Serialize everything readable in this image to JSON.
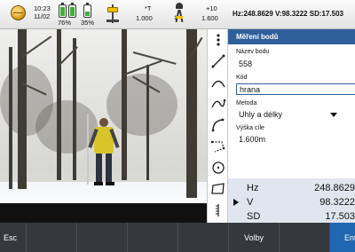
{
  "status_bar": {
    "globe_icon": "globe-icon",
    "time": "10:23",
    "date": "11/02",
    "battery1_percent": "76%",
    "battery1_level": 0.76,
    "battery2_percent": "35%",
    "battery2_level": 0.35,
    "instrument_value": "1.000",
    "instrument_flag": "*T",
    "target_height": "1.600",
    "target_prefix": "1",
    "target_offset": "+10",
    "hv_sd": "Hz:248.8629  V:98.3222  SD:17.503"
  },
  "toolbar": {
    "tools": [
      "more-vert-icon",
      "draw-line-icon",
      "draw-arc-icon",
      "draw-curve-icon",
      "arc-tool-icon",
      "polyline-tool-icon",
      "circle-tool-icon",
      "rectangle-tool-icon",
      "ruler-tool-icon"
    ]
  },
  "panel": {
    "title": "Měření bodů",
    "point_name_label": "Název bodu",
    "point_name_value": "558",
    "code_label": "Kód",
    "code_value": "hrana",
    "method_label": "Metoda",
    "method_value": "Uhly a délky",
    "target_height_label": "Výška cíle",
    "target_height_value": "1.600m"
  },
  "readings": [
    {
      "label": "Hz",
      "value": "248.8629"
    },
    {
      "label": "V",
      "value": "98.3222"
    },
    {
      "label": "SD",
      "value": "17.503"
    }
  ],
  "softkeys": {
    "esc": "Esc",
    "options": "Volby",
    "enter": "Enter"
  },
  "colors": {
    "accent": "#2f5f9a",
    "enter_key": "#1f67b0",
    "softkey_bar": "#35393f",
    "readings_bg": "#dfe6ef"
  }
}
